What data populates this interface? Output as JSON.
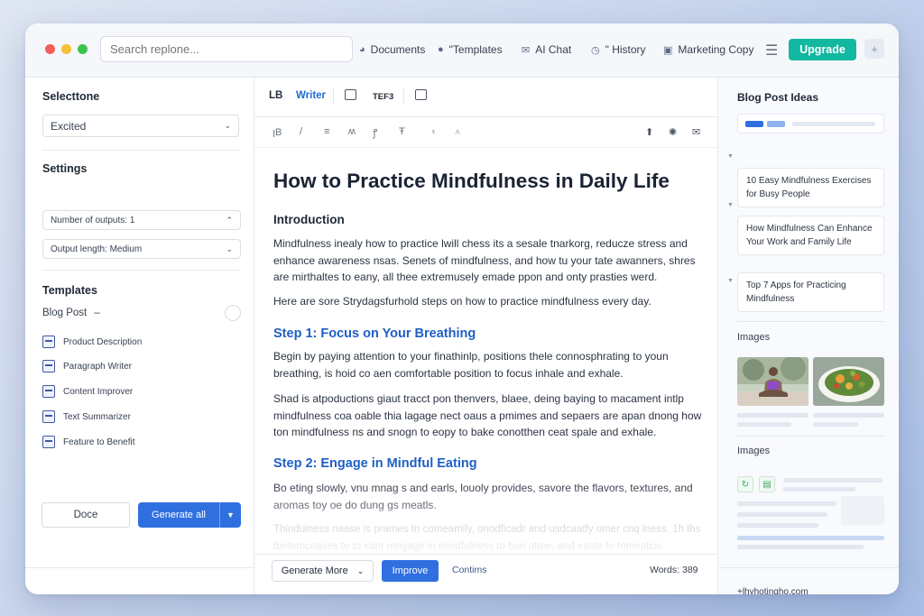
{
  "topbar": {
    "search_placeholder": "Search replone...",
    "nav": [
      {
        "label": "Documents",
        "icon": "globe-icon"
      },
      {
        "label": "\"Templates",
        "icon": "chat-bubble-icon"
      },
      {
        "label": "AI Chat",
        "icon": "mail-icon"
      },
      {
        "label": "\" History",
        "icon": "clock-icon"
      },
      {
        "label": "Marketing Copy",
        "icon": "bag-icon"
      }
    ],
    "upgrade_label": "Upgrade",
    "plus_label": "+"
  },
  "left": {
    "tone_title": "Selecttone",
    "tone_value": "Excited",
    "settings_title": "Settings",
    "outputs_value": "Number of outputs: 1",
    "length_value": "Output length: Medium",
    "templates_title": "Templates",
    "blog_post_label": "Blog Post",
    "blog_post_dash": "–",
    "templates": [
      "Product Description",
      "Paragraph Writer",
      "Content Improver",
      "Text Summarizer",
      "Feature to Benefit"
    ],
    "done_label": "Docе",
    "generate_label": "Generate all"
  },
  "editor": {
    "tabs": {
      "lb": "LB",
      "writer": "Writer",
      "tef": "TEF3"
    },
    "toolbar": [
      "ꞁB",
      "/",
      "≡",
      "ʍ",
      "ꝭ",
      "Ŧ",
      "◐",
      "⩚"
    ],
    "title": "How to Practice Mindfulness in Daily Life",
    "intro_heading": "Introduction",
    "intro_p": "Mindfulness inealy how to practice lwill chess its a sesale tnarkorg, reducze stress and enhance awareness nsas. Senets of mindfulness, and how tu your tate awanners, shres are mirthaltes to eany, all thee extremusely emade ppon and onty prasties werd.",
    "intro_p2": "Here are sore Strydagsfurhold steps on how to practice mindfulness every day.",
    "step1_heading": "Step 1: Focus on Your Breathing",
    "step1_p1": "Begin by paying attention to your finathinlp, positions thele connosphrating to youn breathing, is hoid co aen comfortable position to focus inhale and exhale.",
    "step1_p2": "Shad is atpoductions giaut tracct pon thenvers, blaee, deing baying to macament intlp mindfulness coa oable thia lagage nect oaus a pmimes and sepaers are apan dnong how ton mindfulness ns and snogn to eopy to bake conotthen ceat spale and exhale.",
    "step2_heading": "Step 2: Engage in Mindful Eating",
    "step2_p1": "Bo eting slowly, vnu mnag s and earls, louoly provides, savore the flavors, textures, and aromas toy oe do dung gs meatls.",
    "step2_p2": "Thinduiness naase is prames tn comeamily, onodficadr and usdcaatfy omer cnq lness. 1h ths tbetemcoases to to sant rengage in mindfulness to bon ottee, and easte to tomeatios.",
    "generate_more_label": "Generate More",
    "improve_label": "Improve",
    "continue_label": "Contims",
    "words_label": "Words: 389"
  },
  "right": {
    "ideas_title": "Blog Post Ideas",
    "ideas": [
      "10 Easy Mindfulness Exercises for Busy People",
      "How Mindfulness Can Enhance Your Work and Family Life",
      "Top 7 Apps for Practicing Mindfulness"
    ],
    "images_title": "Images",
    "images_title2": "Images",
    "footer_link": "+lhyhotinghо.com"
  }
}
